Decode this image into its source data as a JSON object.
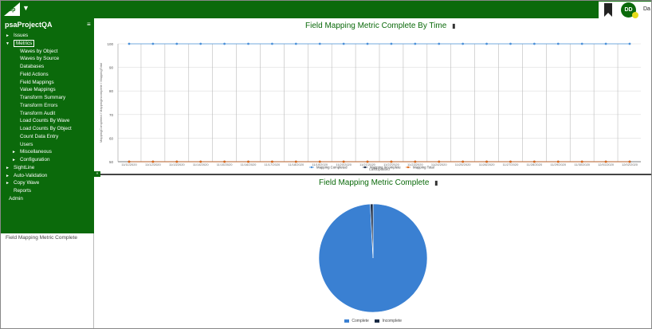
{
  "app": {
    "logo_text": "dsp",
    "user_initials": "DD",
    "user_short": "Da"
  },
  "sidebar": {
    "project_title": "psaProjectQA",
    "items": [
      {
        "label": "Issues",
        "level": 0,
        "arrow": "►"
      },
      {
        "label": "Metrics",
        "level": 0,
        "arrow": "▼",
        "active": true
      },
      {
        "label": "Waves by Object",
        "level": 2
      },
      {
        "label": "Waves by Source",
        "level": 2
      },
      {
        "label": "Databases",
        "level": 2
      },
      {
        "label": "Field Actions",
        "level": 2
      },
      {
        "label": "Field Mappings",
        "level": 2
      },
      {
        "label": "Value Mappings",
        "level": 2
      },
      {
        "label": "Transform Summary",
        "level": 2
      },
      {
        "label": "Transform Errors",
        "level": 2
      },
      {
        "label": "Transform Audit",
        "level": 2
      },
      {
        "label": "Load Counts By Wave",
        "level": 2
      },
      {
        "label": "Load Counts By Object",
        "level": 2
      },
      {
        "label": "Count Data Entry",
        "level": 2
      },
      {
        "label": "Users",
        "level": 2
      },
      {
        "label": "Miscellaneous",
        "level": 1,
        "arrow": "►"
      },
      {
        "label": "Configuration",
        "level": 1,
        "arrow": "►"
      },
      {
        "label": "SightLine",
        "level": 0,
        "arrow": "►"
      },
      {
        "label": "Auto-Validation",
        "level": 0,
        "arrow": "►"
      },
      {
        "label": "Copy Wave",
        "level": 0,
        "arrow": "►"
      },
      {
        "label": "Reports",
        "level": 0
      },
      {
        "label": "Admin",
        "level": -1
      }
    ],
    "lower_panel_text": "Field Mapping Metric Complete"
  },
  "colors": {
    "brand": "#0b6a0b",
    "completed": "#4a90d9",
    "incomplete": "#1a2a44",
    "total": "#e06a1a",
    "pie_complete": "#3a80d2"
  },
  "chart_data": [
    {
      "type": "line",
      "title": "Field Mapping Metric Complete By Time",
      "xlabel": "LastUpdated",
      "ylabel": "MappingCompleted / MappingIncomplete / MappingTotal",
      "ylim": [
        50,
        100
      ],
      "yticks": [
        50,
        60,
        70,
        80,
        90,
        100
      ],
      "x": [
        "11/11/2020",
        "11/12/2020",
        "11/13/2020",
        "11/14/2020",
        "11/15/2020",
        "11/16/2020",
        "11/17/2020",
        "11/18/2020",
        "11/19/2020",
        "11/20/2020",
        "11/21/2020",
        "11/22/2020",
        "11/23/2020",
        "11/24/2020",
        "11/25/2020",
        "11/26/2020",
        "11/27/2020",
        "11/28/2020",
        "11/29/2020",
        "11/30/2020",
        "12/01/2020",
        "12/02/2020"
      ],
      "series": [
        {
          "name": "Mapping Completed",
          "values": [
            100,
            100,
            100,
            100,
            100,
            100,
            100,
            100,
            100,
            100,
            100,
            100,
            100,
            100,
            100,
            100,
            100,
            100,
            100,
            100,
            100,
            100
          ]
        },
        {
          "name": "Mapping Incomplete",
          "values": [
            50,
            50,
            50,
            50,
            50,
            50,
            50,
            50,
            50,
            50,
            50,
            50,
            50,
            50,
            50,
            50,
            50,
            50,
            50,
            50,
            50,
            50
          ]
        },
        {
          "name": "Mapping Total",
          "values": [
            50,
            50,
            50,
            50,
            50,
            50,
            50,
            50,
            50,
            50,
            50,
            50,
            50,
            50,
            50,
            50,
            50,
            50,
            50,
            50,
            50,
            50
          ]
        }
      ],
      "legend": "bottom"
    },
    {
      "type": "pie",
      "title": "Field Mapping Metric Complete",
      "categories": [
        "Complete",
        "Incomplete"
      ],
      "values": [
        99.2,
        0.8
      ],
      "legend": "bottom"
    }
  ]
}
